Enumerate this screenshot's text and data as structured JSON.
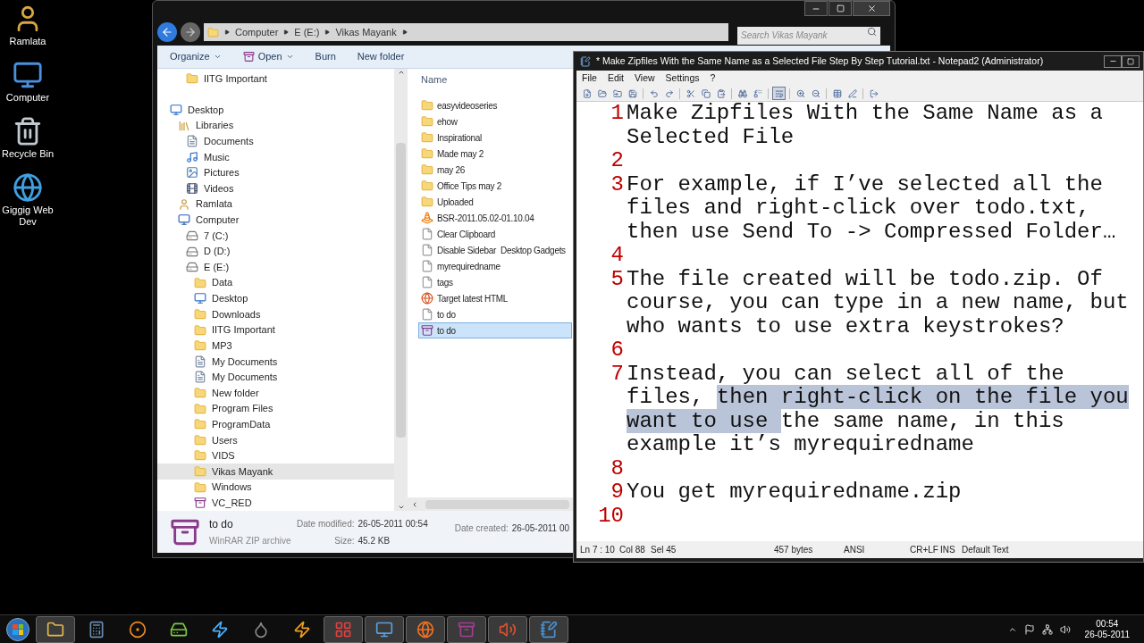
{
  "desktop_icons": [
    {
      "label": "Ramlata",
      "kind": "user"
    },
    {
      "label": "Computer",
      "kind": "computer"
    },
    {
      "label": "Recycle Bin",
      "kind": "bin"
    },
    {
      "label": "Giggig Web Dev",
      "kind": "web"
    }
  ],
  "explorer": {
    "search": {
      "placeholder": "Search Vikas Mayank"
    },
    "breadcrumb": [
      "Computer",
      "E (E:)",
      "Vikas Mayank"
    ],
    "toolbar": [
      {
        "label": "Organize",
        "dropdown": true,
        "kind": "plain"
      },
      {
        "label": "Open",
        "dropdown": true,
        "kind": "archive"
      },
      {
        "label": "Burn",
        "dropdown": false,
        "kind": "plain"
      },
      {
        "label": "New folder",
        "dropdown": false,
        "kind": "plain"
      }
    ],
    "favorites": [
      {
        "label": "IITG Important",
        "kind": "folder",
        "selected": false
      }
    ],
    "tree": [
      {
        "label": "Desktop",
        "kind": "desktop",
        "selected": false,
        "children": [
          {
            "label": "Libraries",
            "kind": "library",
            "selected": false,
            "children": [
              {
                "label": "Documents",
                "kind": "documents",
                "selected": false
              },
              {
                "label": "Music",
                "kind": "music",
                "selected": false
              },
              {
                "label": "Pictures",
                "kind": "pictures",
                "selected": false
              },
              {
                "label": "Videos",
                "kind": "videos",
                "selected": false
              }
            ]
          },
          {
            "label": "Ramlata",
            "kind": "user",
            "selected": false
          },
          {
            "label": "Computer",
            "kind": "computer",
            "selected": false,
            "children": [
              {
                "label": "7 (C:)",
                "kind": "drive",
                "selected": false
              },
              {
                "label": "D (D:)",
                "kind": "drive",
                "selected": false
              },
              {
                "label": "E (E:)",
                "kind": "drive",
                "selected": false,
                "children": [
                  {
                    "label": "Data",
                    "kind": "folder",
                    "selected": false
                  },
                  {
                    "label": "Desktop",
                    "kind": "desktop",
                    "selected": false
                  },
                  {
                    "label": "Downloads",
                    "kind": "folder",
                    "selected": false
                  },
                  {
                    "label": "IITG Important",
                    "kind": "folder",
                    "selected": false
                  },
                  {
                    "label": "MP3",
                    "kind": "folder",
                    "selected": false
                  },
                  {
                    "label": "My Documents",
                    "kind": "documents",
                    "selected": false
                  },
                  {
                    "label": "My Documents",
                    "kind": "documents",
                    "selected": false
                  },
                  {
                    "label": "New folder",
                    "kind": "folder",
                    "selected": false
                  },
                  {
                    "label": "Program Files",
                    "kind": "folder",
                    "selected": false
                  },
                  {
                    "label": "ProgramData",
                    "kind": "folder",
                    "selected": false
                  },
                  {
                    "label": "Users",
                    "kind": "folder",
                    "selected": false
                  },
                  {
                    "label": "VIDS",
                    "kind": "folder",
                    "selected": false
                  },
                  {
                    "label": "Vikas Mayank",
                    "kind": "folder",
                    "selected": true
                  },
                  {
                    "label": "Windows",
                    "kind": "folder",
                    "selected": false
                  },
                  {
                    "label": "VC_RED",
                    "kind": "archive",
                    "selected": false
                  }
                ]
              }
            ]
          }
        ]
      }
    ],
    "column": "Name",
    "files": [
      {
        "name": "easyvideoseries",
        "kind": "folder",
        "selected": false
      },
      {
        "name": "ehow",
        "kind": "folder",
        "selected": false
      },
      {
        "name": "Inspirational",
        "kind": "folder",
        "selected": false
      },
      {
        "name": "Made may 2",
        "kind": "folder",
        "selected": false
      },
      {
        "name": "may 26",
        "kind": "folder",
        "selected": false
      },
      {
        "name": "Office Tips may 2",
        "kind": "folder",
        "selected": false
      },
      {
        "name": "Uploaded",
        "kind": "folder",
        "selected": false
      },
      {
        "name": "BSR-2011.05.02-01.10.04",
        "kind": "media",
        "selected": false
      },
      {
        "name": "Clear Clipboard",
        "kind": "text",
        "selected": false
      },
      {
        "name": "Disable Sidebar  Desktop Gadgets",
        "kind": "text",
        "selected": false
      },
      {
        "name": "myrequiredname",
        "kind": "text",
        "selected": false
      },
      {
        "name": "tags",
        "kind": "text",
        "selected": false
      },
      {
        "name": "Target latest HTML",
        "kind": "web",
        "selected": false
      },
      {
        "name": "to do",
        "kind": "text",
        "selected": false
      },
      {
        "name": "to do",
        "kind": "archive",
        "selected": true
      }
    ],
    "details": {
      "name": "to do",
      "type": "WinRAR ZIP archive",
      "fields": [
        {
          "label": "Date modified:",
          "value": "26-05-2011 00:54"
        },
        {
          "label": "Size:",
          "value": "45.2 KB"
        },
        {
          "label": "Date created:",
          "value": "26-05-2011 00"
        }
      ]
    }
  },
  "notepad": {
    "title": "* Make Zipfiles With the Same Name as a Selected File  Step By Step Tutorial.txt - Notepad2 (Administrator)",
    "menu": [
      "File",
      "Edit",
      "View",
      "Settings",
      "?"
    ],
    "toolbar": [
      {
        "pressed": false
      },
      {
        "pressed": false
      },
      {
        "pressed": false
      },
      {
        "pressed": false
      },
      {
        "pressed": false
      },
      {
        "pressed": false
      },
      {
        "pressed": false
      },
      {
        "pressed": false
      },
      {
        "pressed": false
      },
      {
        "pressed": false
      },
      {
        "pressed": false
      },
      {
        "pressed": true
      },
      {
        "pressed": false
      },
      {
        "pressed": false
      },
      {
        "pressed": false
      },
      {
        "pressed": false
      },
      {
        "pressed": false
      }
    ],
    "lines": [
      {
        "number": "1",
        "rows": [
          [
            {
              "text": "Make Zipfiles With the Same Name as a",
              "selected": false
            }
          ],
          [
            {
              "text": "Selected File",
              "selected": false
            }
          ]
        ]
      },
      {
        "number": "2",
        "rows": [
          []
        ]
      },
      {
        "number": "3",
        "rows": [
          [
            {
              "text": "For example, if I’ve selected all the",
              "selected": false
            }
          ],
          [
            {
              "text": "files and right-click over todo.txt,",
              "selected": false
            }
          ],
          [
            {
              "text": "then use Send To -> Compressed Folder…",
              "selected": false
            }
          ]
        ]
      },
      {
        "number": "4",
        "rows": [
          []
        ]
      },
      {
        "number": "5",
        "rows": [
          [
            {
              "text": "The file created will be todo.zip. Of",
              "selected": false
            }
          ],
          [
            {
              "text": "course, you can type in a new name, but",
              "selected": false
            }
          ],
          [
            {
              "text": "who wants to use extra keystrokes?",
              "selected": false
            }
          ]
        ]
      },
      {
        "number": "6",
        "rows": [
          []
        ]
      },
      {
        "number": "7",
        "rows": [
          [
            {
              "text": "Instead, you can select all of the",
              "selected": false
            }
          ],
          [
            {
              "text": "files, ",
              "selected": false
            },
            {
              "text": "then right-click on the file you",
              "selected": true
            }
          ],
          [
            {
              "text": "want to use ",
              "selected": true
            },
            {
              "text": "the same name, in this",
              "selected": false
            }
          ],
          [
            {
              "text": "example it’s myrequiredname",
              "selected": false
            }
          ]
        ]
      },
      {
        "number": "8",
        "rows": [
          []
        ]
      },
      {
        "number": "9",
        "rows": [
          [
            {
              "text": "You get myrequiredname.zip",
              "selected": false
            }
          ]
        ]
      },
      {
        "number": "10",
        "rows": [
          []
        ]
      }
    ],
    "status": [
      "Ln 7 : 10",
      "Col 88",
      "Sel 45",
      "457 bytes",
      "ANSI",
      "CR+LF",
      "INS",
      "Default Text"
    ]
  },
  "taskbar": {
    "buttons": [
      {
        "running": true
      },
      {
        "running": false
      },
      {
        "running": false
      },
      {
        "running": false
      },
      {
        "running": false
      },
      {
        "running": false
      },
      {
        "running": false
      },
      {
        "running": true
      },
      {
        "running": true
      },
      {
        "running": true
      },
      {
        "running": true
      },
      {
        "running": true
      },
      {
        "running": true
      }
    ],
    "time": "00:54",
    "date": "26-05-2011"
  }
}
